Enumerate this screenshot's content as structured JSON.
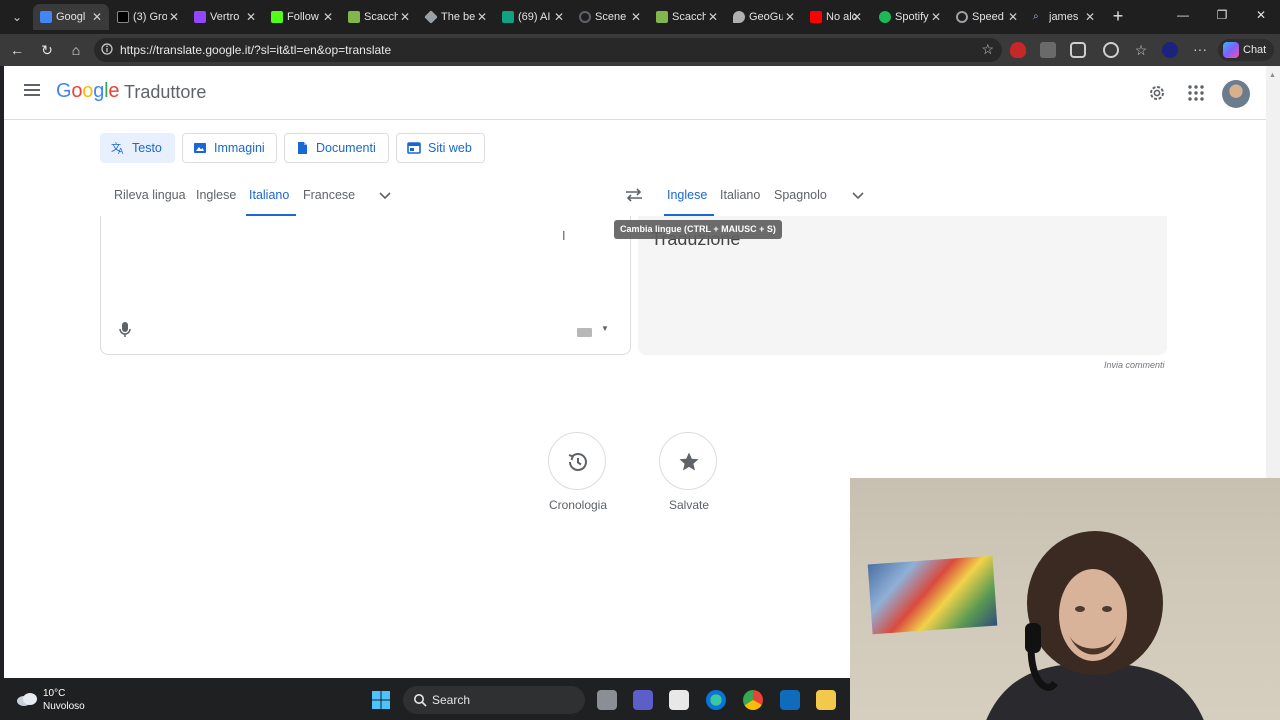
{
  "browser": {
    "tabs": [
      {
        "title": "Googl",
        "color": "#4285f4",
        "active": true
      },
      {
        "title": "(3) Gro",
        "color": "#000000"
      },
      {
        "title": "Vertro",
        "color": "#9146ff"
      },
      {
        "title": "Follow",
        "color": "#53fc18"
      },
      {
        "title": "Scacch",
        "color": "#81b64c"
      },
      {
        "title": "The be",
        "color": "#9aa0a6"
      },
      {
        "title": "(69) AI",
        "color": "#10a37f"
      },
      {
        "title": "Scene",
        "color": "#5f6368"
      },
      {
        "title": "Scacch",
        "color": "#81b64c"
      },
      {
        "title": "GeoGu",
        "color": "#b0b0b0"
      },
      {
        "title": "No alc",
        "color": "#ff0000"
      },
      {
        "title": "Spotify",
        "color": "#1db954"
      },
      {
        "title": "Speed",
        "color": "#9aa0a6"
      },
      {
        "title": "james",
        "color": "#4a90e2"
      }
    ],
    "url": "https://translate.google.it/?sl=it&tl=en&op=translate",
    "chat_label": "Chat"
  },
  "app": {
    "logo": {
      "g1": "G",
      "g2": "o",
      "g3": "o",
      "g4": "g",
      "g5": "l",
      "g6": "e"
    },
    "name": "Traduttore"
  },
  "modes": [
    {
      "label": "Testo",
      "active": true,
      "icon": "translate-icon"
    },
    {
      "label": "Immagini",
      "icon": "image-icon"
    },
    {
      "label": "Documenti",
      "icon": "document-icon"
    },
    {
      "label": "Siti web",
      "icon": "web-icon"
    }
  ],
  "source_langs": {
    "detect": "Rileva lingua",
    "items": [
      "Inglese",
      "Italiano",
      "Francese"
    ],
    "selected": "Italiano"
  },
  "target_langs": {
    "items": [
      "Inglese",
      "Italiano",
      "Spagnolo"
    ],
    "selected": "Inglese"
  },
  "target_placeholder": "Traduzione",
  "swap_tooltip": "Cambia lingue (CTRL + MAIUSC + S)",
  "feedback_link": "Invia commenti",
  "features": [
    {
      "label": "Cronologia",
      "icon": "history-icon"
    },
    {
      "label": "Salvate",
      "icon": "star-icon"
    }
  ],
  "taskbar": {
    "temperature": "10°C",
    "weather": "Nuvoloso",
    "search_label": "Search"
  }
}
